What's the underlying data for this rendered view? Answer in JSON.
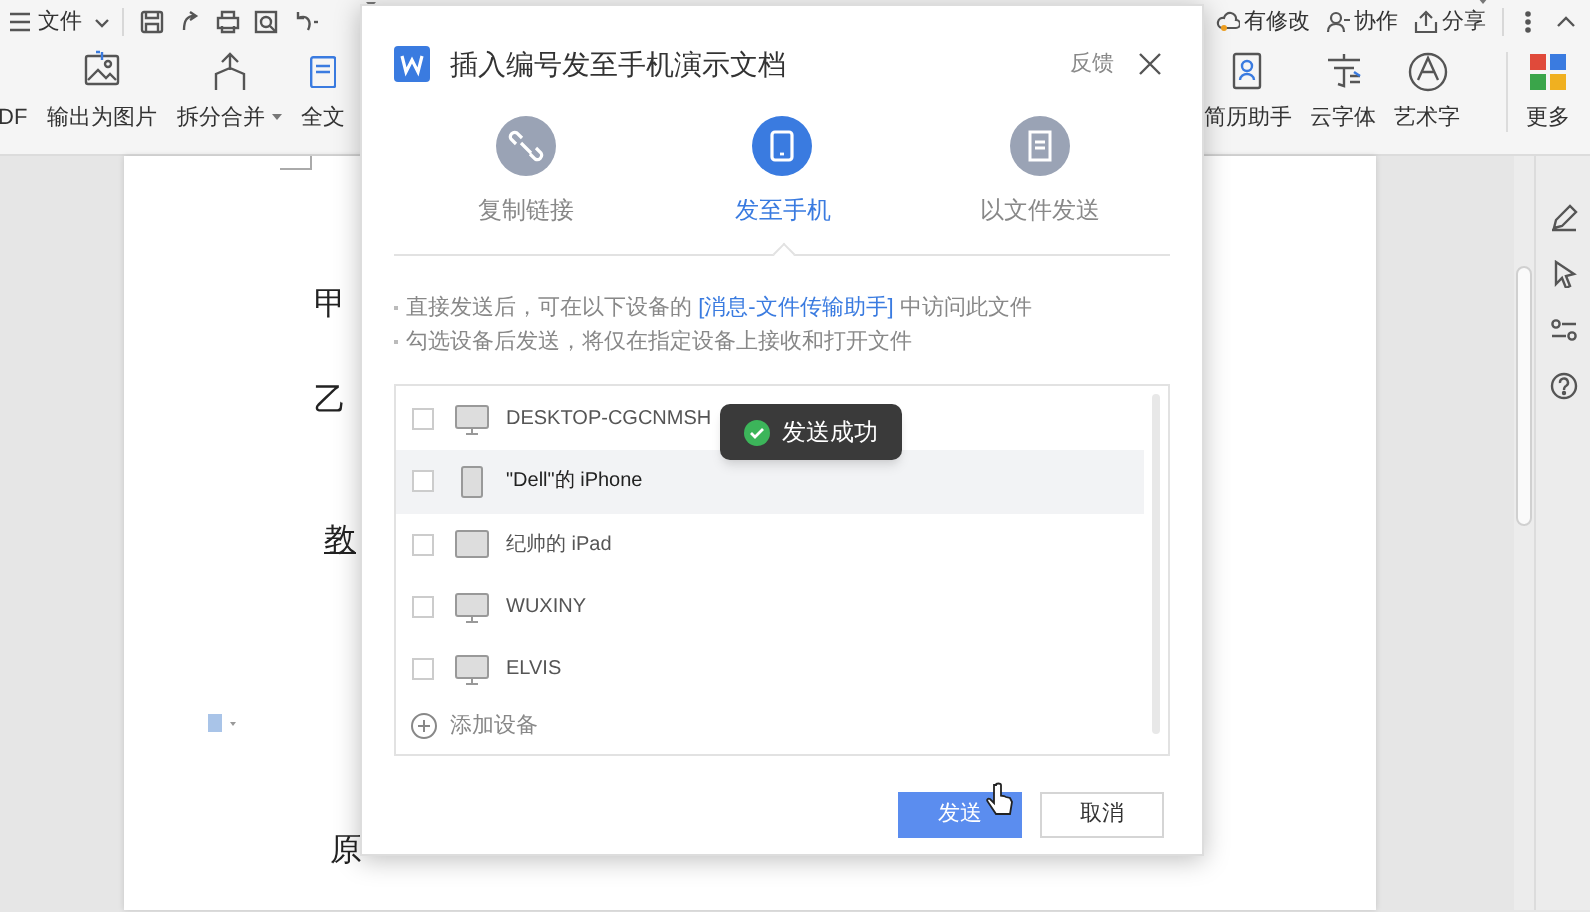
{
  "menu_bar": {
    "file_menu": "文件",
    "actions": [
      {
        "label": "有修改"
      },
      {
        "label": "协作"
      },
      {
        "label": "分享"
      }
    ]
  },
  "ribbon_left": [
    {
      "label": "DF",
      "dropdown": false
    },
    {
      "label": "输出为图片",
      "dropdown": false
    },
    {
      "label": "拆分合并",
      "dropdown": true
    },
    {
      "label": "全文",
      "dropdown": false
    }
  ],
  "ribbon_right": [
    {
      "label": "简历助手"
    },
    {
      "label": "云字体"
    },
    {
      "label": "艺术字"
    },
    {
      "label": "更多"
    }
  ],
  "document": {
    "lines": [
      {
        "text": "甲",
        "underlined": false
      },
      {
        "text": "乙",
        "underlined": false
      },
      {
        "text": "教",
        "underlined": true
      },
      {
        "text": "原",
        "underlined": false
      }
    ]
  },
  "dialog": {
    "title": "插入编号发至手机演示文档",
    "feedback": "反馈",
    "tabs": [
      {
        "label": "复制链接",
        "selected": false
      },
      {
        "label": "发至手机",
        "selected": true
      },
      {
        "label": "以文件发送",
        "selected": false
      }
    ],
    "note_1": {
      "before": "直接发送后，可在以下设备的 ",
      "link": "[消息-文件传输助手]",
      "after": " 中访问此文件"
    },
    "note_2": "勾选设备后发送，将仅在指定设备上接收和打开文件",
    "devices": [
      {
        "name": "DESKTOP-CGCNMSH",
        "kind": "desktop",
        "checked": false,
        "hovered": false
      },
      {
        "name": "\"Dell\"的 iPhone",
        "kind": "phone",
        "checked": false,
        "hovered": true
      },
      {
        "name": "纪帅的 iPad",
        "kind": "tablet",
        "checked": false,
        "hovered": false
      },
      {
        "name": "WUXINY",
        "kind": "desktop",
        "checked": false,
        "hovered": false
      },
      {
        "name": "ELVIS",
        "kind": "desktop",
        "checked": false,
        "hovered": false
      }
    ],
    "add_device": "添加设备",
    "buttons": [
      {
        "label": "发送",
        "primary": true
      },
      {
        "label": "取消",
        "primary": false
      }
    ]
  },
  "toast": "发送成功"
}
